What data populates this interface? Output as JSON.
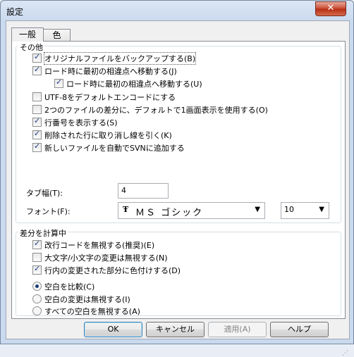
{
  "window": {
    "title": "設定",
    "close_glyph": "✕"
  },
  "tabs": [
    {
      "label": "一般"
    },
    {
      "label": "色"
    }
  ],
  "other_group": {
    "label": "その他",
    "options": [
      {
        "label": "オリジナルファイルをバックアップする(B)",
        "checked": true
      },
      {
        "label": "ロード時に最初の相違点へ移動する(J)",
        "checked": true
      },
      {
        "label": "ロード時に最初の相違点へ移動する(U)",
        "checked": true
      },
      {
        "label": "UTF-8をデフォルトエンコードにする",
        "checked": false
      },
      {
        "label": "2つのファイルの差分に、デフォルトで1画面表示を使用する(O)",
        "checked": false
      },
      {
        "label": "行番号を表示する(S)",
        "checked": true
      },
      {
        "label": "削除された行に取り消し線を引く(K)",
        "checked": true
      },
      {
        "label": "新しいファイルを自動でSVNに追加する",
        "checked": true
      }
    ],
    "tab_width": {
      "label": "タブ幅(T):",
      "value": "4"
    },
    "font": {
      "label": "フォント(F):",
      "glyph": "Ŧ",
      "value": "ＭＳ ゴシック",
      "size": "10"
    }
  },
  "diff_group": {
    "label": "差分を計算中",
    "options": [
      {
        "label": "改行コードを無視する(推奨)(E)",
        "checked": true
      },
      {
        "label": "大文字/小文字の変更は無視する(N)",
        "checked": false
      },
      {
        "label": "行内の変更された部分に色付けする(D)",
        "checked": true
      }
    ],
    "radios": [
      {
        "label": "空白を比較(C)",
        "selected": true
      },
      {
        "label": "空白の変更は無視する(I)",
        "selected": false
      },
      {
        "label": "すべての空白を無視する(A)",
        "selected": false
      }
    ]
  },
  "buttons": {
    "ok": "OK",
    "cancel": "キャンセル",
    "apply": "適用(A)",
    "help": "ヘルプ"
  },
  "colors": {
    "accent": "#3c7fb1",
    "check": "#1f3b8a"
  }
}
